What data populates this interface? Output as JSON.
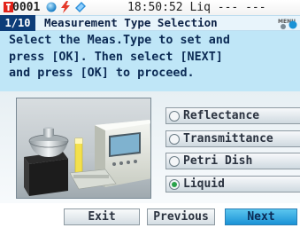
{
  "status": {
    "record_number": "0001",
    "time": "18:50:52",
    "trailing": "Liq --- ---",
    "icons": [
      "record-icon",
      "status-dot-icon",
      "power-bolt-icon",
      "sensor-icon"
    ]
  },
  "header": {
    "page": "1/10",
    "title": "Measurement Type Selection",
    "menu_icon": "menu-icon"
  },
  "instruction": {
    "lines": [
      "Select the Meas.Type to set and",
      "press [OK]. Then select [NEXT]",
      "and press [OK] to proceed."
    ]
  },
  "illustration": {
    "icon": "instrument-illustration-icon"
  },
  "options": [
    {
      "label": "Reflectance",
      "selected": false
    },
    {
      "label": "Transmittance",
      "selected": false
    },
    {
      "label": "Petri Dish",
      "selected": false
    },
    {
      "label": "Liquid",
      "selected": true
    }
  ],
  "buttons": {
    "exit": "Exit",
    "previous": "Previous",
    "next": "Next"
  },
  "colors": {
    "accent": "#1a92d6",
    "page_badge": "#0d3c78",
    "instruction_bg": "#bfe6f7",
    "record_icon": "#e2231a",
    "selected_radio": "#2aa24a"
  }
}
